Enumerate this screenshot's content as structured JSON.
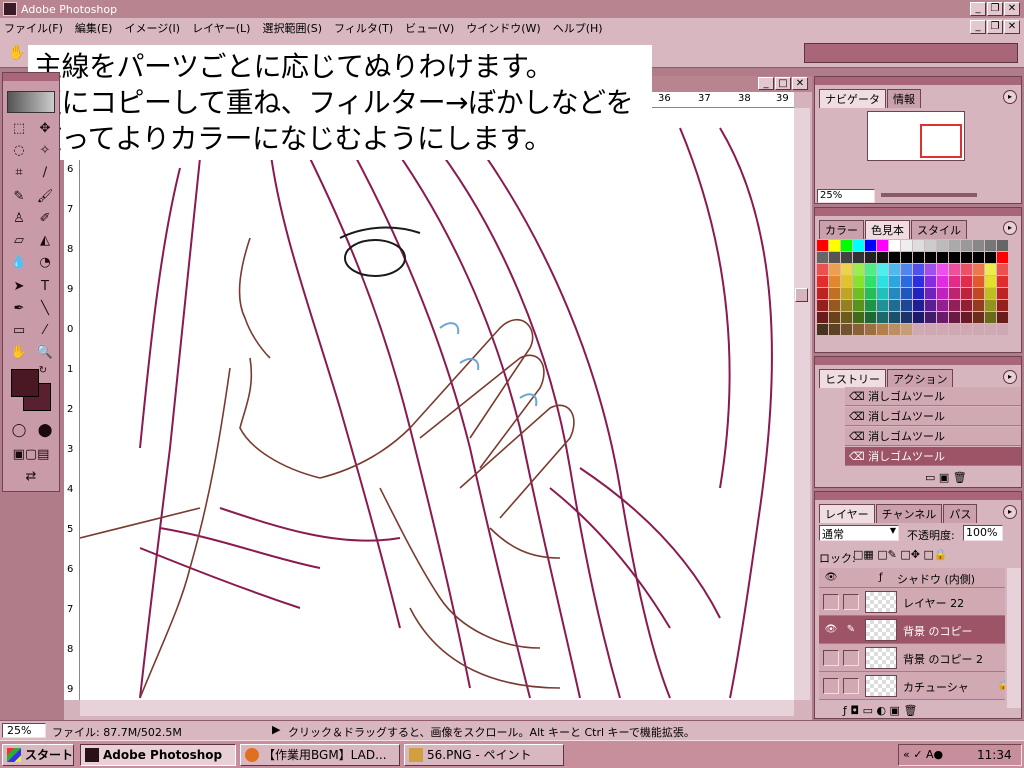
{
  "app": {
    "title": "Adobe Photoshop"
  },
  "menu": [
    "ファイル(F)",
    "編集(E)",
    "イメージ(I)",
    "レイヤー(L)",
    "選択範囲(S)",
    "フィルタ(T)",
    "ビュー(V)",
    "ウインドウ(W)",
    "ヘルプ(H)"
  ],
  "caption": {
    "line1": "主線をパーツごとに応じてぬりわけます。",
    "line2": "更にコピーして重ね、フィルター→ぼかしなどを",
    "line3": "使ってよりカラーになじむようにします。"
  },
  "rulers": {
    "top": [
      "36",
      "37",
      "38",
      "39"
    ],
    "left": [
      "6",
      "7",
      "8",
      "9",
      "0",
      "1",
      "2",
      "3",
      "4",
      "5",
      "6",
      "7",
      "8",
      "9"
    ]
  },
  "navigator": {
    "tabs": [
      "ナビゲータ",
      "情報"
    ],
    "zoom": "25%"
  },
  "color": {
    "tabs": [
      "カラー",
      "色見本",
      "スタイル"
    ],
    "swatches": [
      "#ff0000",
      "#ffff00",
      "#00ff00",
      "#00ffff",
      "#0000ff",
      "#ff00ff",
      "#ffffff",
      "#eeeeee",
      "#dddddd",
      "#cccccc",
      "#bbbbbb",
      "#aaaaaa",
      "#999999",
      "#888888",
      "#777777",
      "#666666",
      "#555555",
      "#444444",
      "#333333",
      "#222222",
      "#111111",
      "#000000",
      "#000000",
      "#000000",
      "#000000",
      "#000000",
      "#000000",
      "#000000",
      "#000000",
      "#000000"
    ]
  },
  "history": {
    "tabs": [
      "ヒストリー",
      "アクション"
    ],
    "items": [
      "消しゴムツール",
      "消しゴムツール",
      "消しゴムツール",
      "消しゴムツール"
    ]
  },
  "layers": {
    "tabs": [
      "レイヤー",
      "チャンネル",
      "パス"
    ],
    "mode": "通常",
    "opacity_label": "不透明度:",
    "opacity": "100%",
    "lock_label": "ロック:",
    "items": [
      {
        "name": "シャドウ (内側)"
      },
      {
        "name": "レイヤー 22"
      },
      {
        "name": "背景 のコピー"
      },
      {
        "name": "背景 のコピー 2"
      },
      {
        "name": "カチューシャ"
      }
    ]
  },
  "status": {
    "zoom": "25%",
    "file": "ファイル: 87.7M/502.5M",
    "hint": "クリック＆ドラッグすると、画像をスクロール。Alt キーと Ctrl キーで機能拡張。"
  },
  "taskbar": {
    "start": "スタート",
    "apps": [
      "Adobe Photoshop",
      "【作業用BGM】LAD...",
      "56.PNG - ペイント"
    ],
    "clock": "11:34"
  }
}
